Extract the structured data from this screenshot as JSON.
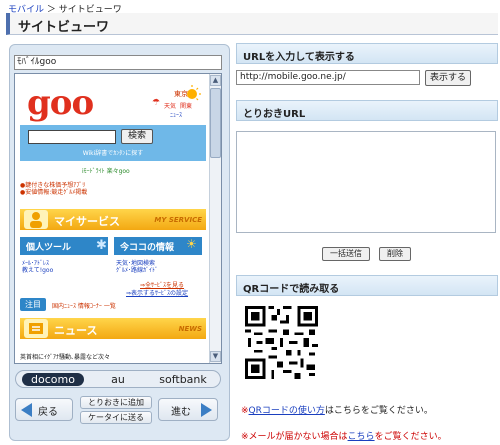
{
  "breadcrumb": {
    "home": "モバイル",
    "separator": "＞",
    "current": "サイトビューワ"
  },
  "page_title": "サイトビューワ",
  "phone": {
    "address": "ﾓﾊﾞｲﾙgoo",
    "goo_logo": "goo",
    "weather": {
      "region": "東京",
      "sub1": "天気",
      "sub2": "関東",
      "sub3": "ﾆｭｰｽ"
    },
    "search_button": "検索",
    "search_hint": "Wiki辞書でｶﾝﾀﾝに探す",
    "promo_line": "iﾓｰﾄﾞﾗｲﾄ 楽々goo",
    "links_left": [
      "●鍵付きな株価予想ｱﾌﾟﾘ",
      "●安値情報:競走ｸﾞﾙﾒ掲載"
    ],
    "my_service": {
      "title": "マイサービス",
      "sub": "MY SERVICE"
    },
    "tiles": [
      {
        "label": "個人ツール",
        "lines": [
          "ﾒｰﾙ･ｱﾄﾞﾚｽ",
          "教えて!goo"
        ]
      },
      {
        "label": "今ココの情報",
        "lines": [
          "天気･地図検索",
          "ｸﾞﾙﾒ･路線ｶﾞｲﾄﾞ"
        ]
      }
    ],
    "more_link": "⇒全ｻｰﾋﾞｽを見る",
    "more_link2": "⇒表示するｻｰﾋﾞｽの設定",
    "notice_tag": "注目",
    "notice_text": "国内ﾆｭｰｽ 情報ｺｰﾅｰ 一覧",
    "news": {
      "title": "ニュース",
      "sub": "NEWS"
    },
    "bottom_text": "英首相にｲｸﾞｱﾅ騒動､暴露など次々"
  },
  "carriers": [
    "docomo",
    "au",
    "softbank"
  ],
  "selected_carrier": "docomo",
  "nav": {
    "back": "戻る",
    "add_saved": "とりおきに追加",
    "send_mobile": "ケータイに送る",
    "forward": "進む"
  },
  "url_section": {
    "heading": "URLを入力して表示する",
    "value": "http://mobile.goo.ne.jp/",
    "button": "表示する"
  },
  "saved_section": {
    "heading": "とりおきURL",
    "send_all": "一括送信",
    "delete": "削除"
  },
  "qr_section": {
    "heading": "QRコードで読み取る",
    "note_prefix": "※",
    "note_link": "QRコードの使い方",
    "note_suffix": "はこちらをご覧ください。",
    "warn_prefix": "※メールが届かない場合は",
    "warn_link": "こちら",
    "warn_suffix": "をご覧ください。"
  },
  "colors": {
    "accent_red": "#cc0000",
    "goo_red": "#e0301e",
    "link_blue": "#1a3fbf"
  }
}
